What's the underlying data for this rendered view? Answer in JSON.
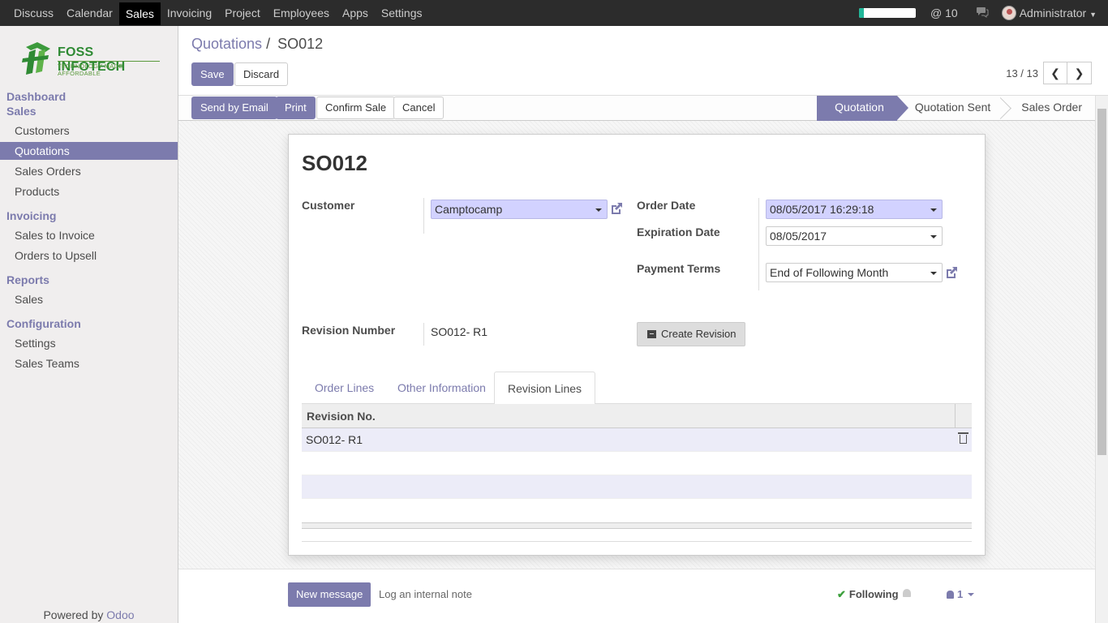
{
  "topbar": {
    "menus": [
      "Discuss",
      "Calendar",
      "Sales",
      "Invoicing",
      "Project",
      "Employees",
      "Apps",
      "Settings"
    ],
    "active_menu": "Sales",
    "progress_fraction": 0.08,
    "mentions": "@ 10",
    "user": "Administrator"
  },
  "sidebar": {
    "logo_brand": "FOSS INFOTECH",
    "logo_tagline": "TECHNOLOGY MADE AFFORDABLE",
    "sections": [
      {
        "title": "Dashboard",
        "items": []
      },
      {
        "title": "Sales",
        "items": [
          "Customers",
          "Quotations",
          "Sales Orders",
          "Products"
        ]
      },
      {
        "title": "Invoicing",
        "items": [
          "Sales to Invoice",
          "Orders to Upsell"
        ]
      },
      {
        "title": "Reports",
        "items": [
          "Sales"
        ]
      },
      {
        "title": "Configuration",
        "items": [
          "Settings",
          "Sales Teams"
        ]
      }
    ],
    "active_item": "Quotations",
    "powered_by": "Powered by",
    "powered_brand": "Odoo"
  },
  "control": {
    "breadcrumb_parent": "Quotations",
    "breadcrumb_sep": "/",
    "breadcrumb_current": "SO012",
    "save_label": "Save",
    "discard_label": "Discard",
    "pager": "13 / 13"
  },
  "statusbar": {
    "buttons": [
      "Send by Email",
      "Print",
      "Confirm Sale",
      "Cancel"
    ],
    "stages": [
      "Quotation",
      "Quotation Sent",
      "Sales Order"
    ],
    "current_stage": "Quotation"
  },
  "form": {
    "title": "SO012",
    "customer_label": "Customer",
    "customer_value": "Camptocamp",
    "order_date_label": "Order Date",
    "order_date_value": "08/05/2017 16:29:18",
    "expiration_label": "Expiration Date",
    "expiration_value": "08/05/2017",
    "payment_terms_label": "Payment Terms",
    "payment_terms_value": "End of Following Month",
    "revision_label": "Revision Number",
    "revision_value": "SO012- R1",
    "create_revision_label": "Create Revision",
    "tabs": [
      "Order Lines",
      "Other Information",
      "Revision Lines"
    ],
    "active_tab": "Revision Lines",
    "table": {
      "columns": [
        "Revision No."
      ],
      "rows": [
        [
          "SO012- R1"
        ]
      ]
    }
  },
  "chatter": {
    "new_message": "New message",
    "log_note": "Log an internal note",
    "following": "Following",
    "followers_count": "1"
  }
}
